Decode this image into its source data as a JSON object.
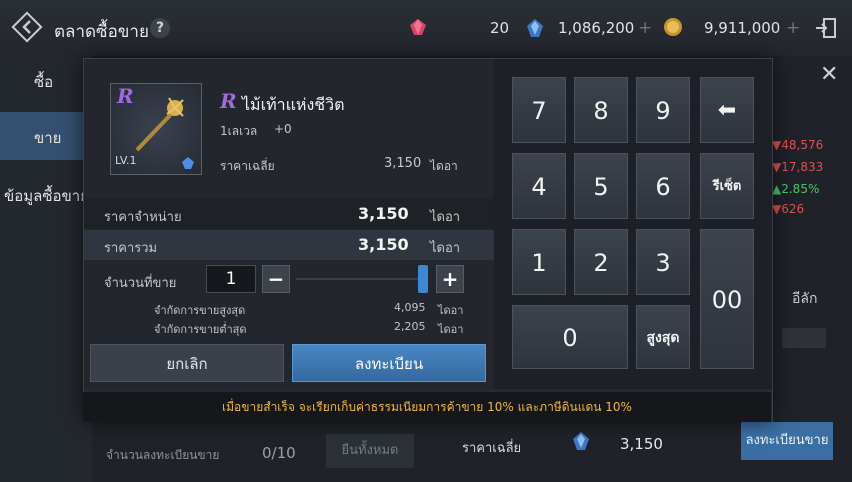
{
  "header": {
    "title": "ตลาดซื้อขาย",
    "help_label": "?",
    "currency": [
      {
        "icon": "gem-icon",
        "value": "20",
        "color": "#e0456a"
      },
      {
        "icon": "blue-crystal-icon",
        "value": "1,086,200",
        "color": "#4d8fe0"
      },
      {
        "icon": "gold-coin-icon",
        "value": "9,911,000",
        "color": "#d6a640"
      }
    ],
    "plus_label": "+"
  },
  "sidebar": {
    "items": [
      {
        "label": "ซื้อ"
      },
      {
        "label": "ขาย"
      },
      {
        "label": "ข้อมูลซื้อขาย"
      }
    ]
  },
  "background": {
    "changes": [
      {
        "value": "▼48,576",
        "color": "#e05050"
      },
      {
        "value": "▼17,833",
        "color": "#e05050"
      },
      {
        "value": "▲2.85%",
        "color": "#4cc46a"
      },
      {
        "value": "▼626",
        "color": "#e05050"
      }
    ],
    "side_text": "อีลัก",
    "avg_label": "ราคาเฉลี่ย",
    "avg_value": "3,150",
    "register_sell_label": "ลงทะเบียนขาย",
    "register_count_label": "จำนวนลงทะเบียนขาย",
    "register_count_value": "0/10",
    "cancel_all_label": "ยืนทั้งหมด",
    "close_label": "✕"
  },
  "item": {
    "name": "ไม้เท้าแห่งชีวิต",
    "grade": "R",
    "level_text": "1เลเวล",
    "enhance": "+0",
    "lv_badge": "LV.1",
    "avg_price_label": "ราคาเฉลี่ย",
    "avg_price_value": "3,150",
    "unit": "ไดอา"
  },
  "sale": {
    "price_label": "ราคาจำหน่าย",
    "price_value": "3,150",
    "total_label": "ราคารวม",
    "total_value": "3,150",
    "qty_label": "จำนวนที่ขาย",
    "qty_value": "1",
    "minus_label": "−",
    "plus_label": "+",
    "max_limit_label": "จำกัดการขายสูงสุด",
    "max_limit_value": "4,095",
    "min_limit_label": "จำกัดการขายต่ำสุด",
    "min_limit_value": "2,205",
    "unit": "ไดอา",
    "cancel_label": "ยกเลิก",
    "register_label": "ลงทะเบียน"
  },
  "numpad": {
    "keys": [
      "7",
      "8",
      "9",
      "4",
      "5",
      "6",
      "1",
      "2",
      "3",
      "0"
    ],
    "backspace": "⬅",
    "reset": "รีเซ็ต",
    "double_zero": "00",
    "max": "สูงสุด"
  },
  "notice": "เมื่อขายสำเร็จ จะเรียกเก็บค่าธรรมเนียมการค้าขาย 10% และภาษีดินแดน 10%"
}
